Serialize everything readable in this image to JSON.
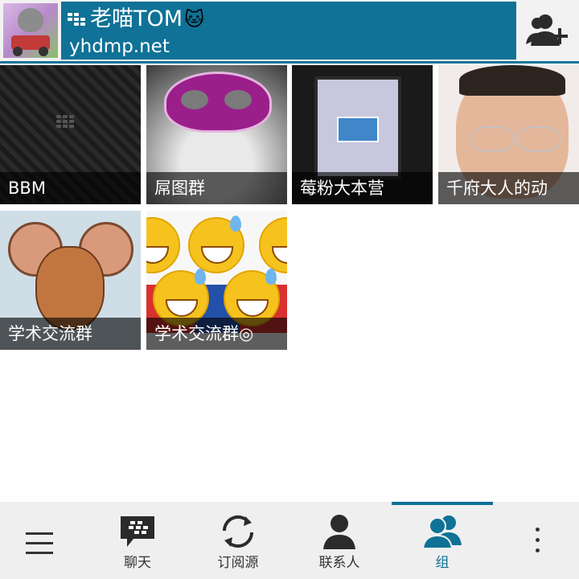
{
  "header": {
    "display_name": "老喵TOM",
    "name_emoji": "🐱",
    "status": "yhdmp.net",
    "add_contact_icon": "add-contact-icon"
  },
  "groups": [
    {
      "label": "BBM",
      "thumbnail": "blackberry-pattern"
    },
    {
      "label": "屌图群",
      "thumbnail": "husky-with-mask"
    },
    {
      "label": "莓粉大本营",
      "thumbnail": "laptop-screen"
    },
    {
      "label": "千府大人的动",
      "thumbnail": "child-with-glasses"
    },
    {
      "label": "学术交流群",
      "thumbnail": "jerry-mouse"
    },
    {
      "label": "学术交流群◎",
      "thumbnail": "sweat-smile-emoji"
    }
  ],
  "bottom_nav": {
    "items": [
      {
        "label": "聊天",
        "icon": "chat-icon"
      },
      {
        "label": "订阅源",
        "icon": "refresh-feeds-icon"
      },
      {
        "label": "联系人",
        "icon": "contact-icon"
      },
      {
        "label": "组",
        "icon": "groups-icon"
      }
    ],
    "active_index": 3
  },
  "colors": {
    "accent": "#0f7296",
    "bar_bg": "#efefef"
  }
}
